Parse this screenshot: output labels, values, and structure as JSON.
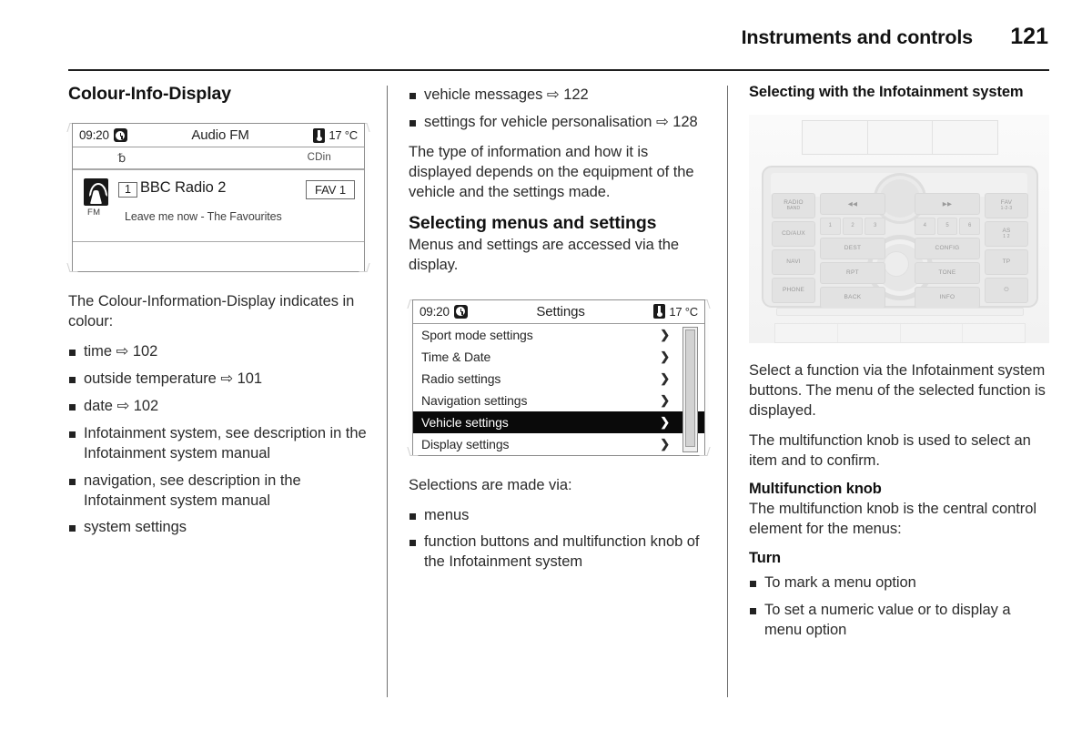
{
  "header": {
    "chapter": "Instruments and controls",
    "page_number": "121"
  },
  "ref_arrow_glyph": "⇨",
  "column1": {
    "title": "Colour-Info-Display",
    "radio_display": {
      "time": "09:20",
      "clock_icon": "clock-icon",
      "title": "Audio FM",
      "temperature": "17 °C",
      "thermometer_icon": "thermometer-icon",
      "bluetooth_icon": "bluetooth-icon",
      "source_label": "CDin",
      "band_label": "FM",
      "preset_number": "1",
      "station_name": "BBC Radio 2",
      "favourite_label": "FAV 1",
      "track_info": "Leave me now - The Favourites"
    },
    "intro": "The Colour-Information-Display indicates in colour:",
    "bullets": [
      "time ⇨ 102",
      "outside temperature ⇨ 101",
      "date ⇨ 102",
      "Infotainment system, see description in the Infotainment system manual",
      "navigation, see description in the Infotainment system manual",
      "system settings"
    ]
  },
  "column2": {
    "bullets_top": [
      "vehicle messages ⇨ 122",
      "settings for vehicle personalisation ⇨ 128"
    ],
    "paragraph_1": "The type of information and how it is displayed depends on the equipment of the vehicle and the settings made.",
    "section_title": "Selecting menus and settings",
    "paragraph_2": "Menus and settings are accessed via the display.",
    "settings_display": {
      "time": "09:20",
      "clock_icon": "clock-icon",
      "title": "Settings",
      "temperature": "17 °C",
      "thermometer_icon": "thermometer-icon",
      "chevron_glyph": "❯",
      "menu_items": [
        {
          "label": "Sport mode settings",
          "selected": false
        },
        {
          "label": "Time & Date",
          "selected": false
        },
        {
          "label": "Radio settings",
          "selected": false
        },
        {
          "label": "Navigation settings",
          "selected": false
        },
        {
          "label": "Vehicle settings",
          "selected": true
        },
        {
          "label": "Display settings",
          "selected": false
        }
      ]
    },
    "selections_intro": "Selections are made via:",
    "selections_bullets": [
      "menus",
      "function buttons and multifunction knob of the Infotainment system"
    ]
  },
  "column3": {
    "section_title": "Selecting with the Infotainment system",
    "control_panel": {
      "left_buttons": [
        {
          "label": "RADIO",
          "sub": "BAND"
        },
        {
          "label": "CD/AUX",
          "sub": ""
        },
        {
          "label": "NAVI",
          "sub": ""
        },
        {
          "label": "PHONE",
          "sub": ""
        }
      ],
      "right_buttons": [
        {
          "label": "FAV",
          "sub": "1-2-3"
        },
        {
          "label": "AS",
          "sub": "1 2"
        },
        {
          "label": "TP",
          "sub": ""
        },
        {
          "label": "⏻",
          "sub": ""
        }
      ],
      "mid_left_buttons": [
        "◀◀",
        "DEST",
        "RPT",
        "BACK"
      ],
      "mid_right_buttons": [
        "▶▶",
        "CONFIG",
        "TONE",
        "INFO"
      ],
      "preset_numbers_left": [
        "1",
        "2",
        "3"
      ],
      "preset_numbers_right": [
        "4",
        "5",
        "6"
      ]
    },
    "paragraph_1": "Select a function via the Infotainment system buttons. The menu of the selected function is displayed.",
    "paragraph_2": "The multifunction knob is used to select an item and to confirm.",
    "sub_title_1": "Multifunction knob",
    "paragraph_3": "The multifunction knob is the central control element for the menus:",
    "sub_title_2": "Turn",
    "turn_bullets": [
      "To mark a menu option",
      "To set a numeric value or to display a menu option"
    ]
  }
}
